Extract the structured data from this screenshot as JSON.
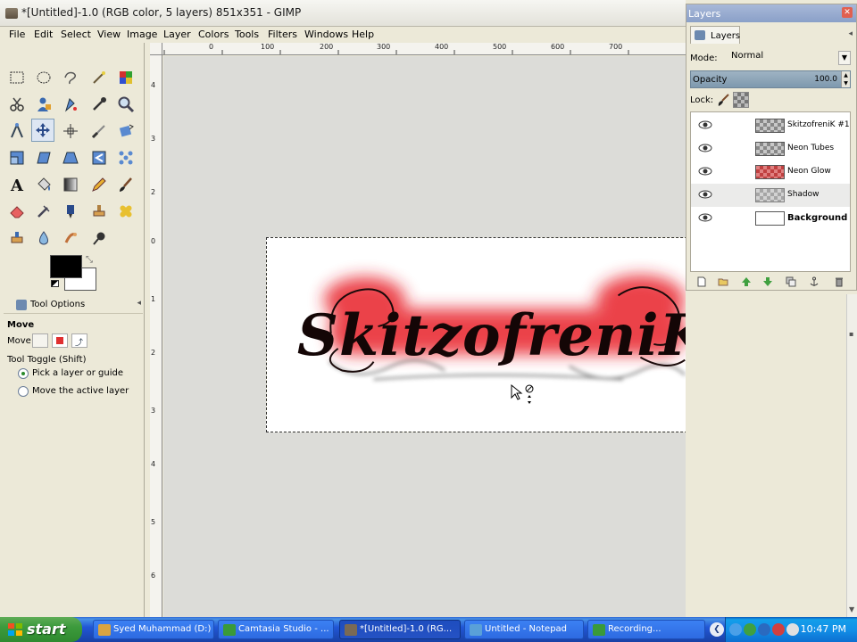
{
  "window": {
    "title": "*[Untitled]-1.0 (RGB color, 5 layers) 851x351 - GIMP"
  },
  "menu": [
    "File",
    "Edit",
    "Select",
    "View",
    "Image",
    "Layer",
    "Colors",
    "Tools",
    "Filters",
    "Windows",
    "Help"
  ],
  "ruler": {
    "top": [
      "0",
      "100",
      "200",
      "300",
      "400",
      "500",
      "600",
      "700"
    ],
    "left": [
      "4",
      "3",
      "2",
      "1",
      "0",
      "1",
      "2",
      "3",
      "4",
      "5",
      "6"
    ]
  },
  "toolbox": {
    "tools": [
      "rect-select",
      "ellipse-select",
      "free-select",
      "fuzzy-select",
      "by-color-select",
      "scissors",
      "foreground-select",
      "paths",
      "color-picker",
      "zoom",
      "measure",
      "move",
      "align",
      "crop",
      "rotate",
      "scale",
      "shear",
      "perspective",
      "flip",
      "text",
      "bucket-fill",
      "blend",
      "pencil",
      "paintbrush",
      "eraser",
      "airbrush",
      "ink",
      "clone",
      "heal",
      "perspective-clone",
      "smudge",
      "blur",
      "dodge-burn",
      "unknown"
    ],
    "active_tool": "move"
  },
  "tool_options": {
    "tab_label": "Tool Options",
    "title": "Move",
    "move_label": "Move:",
    "toggle_label": "Tool Toggle  (Shift)",
    "option_pick": "Pick a layer or guide",
    "option_move_active": "Move the active layer"
  },
  "layers_panel": {
    "window_title": "Layers",
    "tab_label": "Layers",
    "mode_label": "Mode:",
    "mode_value": "Normal",
    "opacity_label": "Opacity",
    "opacity_value": "100.0",
    "lock_label": "Lock:",
    "layers": [
      {
        "name": "SkitzofreniK #1",
        "thumb": "checker"
      },
      {
        "name": "Neon Tubes",
        "thumb": "checker"
      },
      {
        "name": "Neon Glow",
        "thumb": "red"
      },
      {
        "name": "Shadow",
        "thumb": "checker"
      },
      {
        "name": "Background",
        "thumb": "white"
      }
    ],
    "selected_index": 3
  },
  "canvas": {
    "artwork_text": "SkitzofreniK"
  },
  "taskbar": {
    "start_label": "start",
    "tasks": [
      {
        "label": "Syed Muhammad (D:)",
        "icon_color": "#d9a441"
      },
      {
        "label": "Camtasia Studio - ...",
        "icon_color": "#3a9a3a"
      },
      {
        "label": "*[Untitled]-1.0 (RG...",
        "icon_color": "#7a6a55"
      },
      {
        "label": "Untitled - Notepad",
        "icon_color": "#5aa0d8"
      },
      {
        "label": "Recording...",
        "icon_color": "#3a9a3a"
      }
    ],
    "active_task": 2,
    "clock": "10:47 PM"
  },
  "colors": {
    "accent": "#3168d5",
    "glow": "#e8202a"
  }
}
